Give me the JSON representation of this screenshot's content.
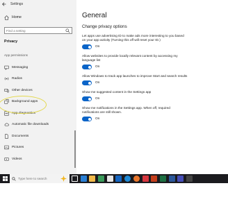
{
  "window": {
    "app_title": "Settings"
  },
  "sidebar": {
    "home_label": "Home",
    "search_placeholder": "Find a setting",
    "section_title": "Privacy",
    "group_label": "App permissions",
    "items": [
      {
        "label": "Messaging",
        "icon": "message-icon"
      },
      {
        "label": "Radios",
        "icon": "radio-icon"
      },
      {
        "label": "Other devices",
        "icon": "devices-icon"
      },
      {
        "label": "Background apps",
        "icon": "background-apps-icon"
      },
      {
        "label": "App diagnostics",
        "icon": "diagnostics-icon"
      },
      {
        "label": "Automatic file downloads",
        "icon": "cloud-icon"
      },
      {
        "label": "Documents",
        "icon": "document-icon"
      },
      {
        "label": "Pictures",
        "icon": "picture-icon"
      },
      {
        "label": "Videos",
        "icon": "video-icon"
      }
    ]
  },
  "main": {
    "title": "General",
    "subheading": "Change privacy options",
    "settings": [
      {
        "text": "Let apps use advertising ID to make ads more interesting to you based on your app activity (Turning this off will reset your ID.)",
        "state": "On"
      },
      {
        "text": "Allow websites to provide locally relevant content by accessing my language list",
        "state": "On"
      },
      {
        "text": "Allow Windows to track app launches to improve Start and search results",
        "state": "On"
      },
      {
        "text": "Show me suggested content in the Settings app",
        "state": "On"
      },
      {
        "text": "Show me notifications in the Settings app. When off, required notifications are still shown.",
        "state": "On"
      }
    ]
  },
  "taskbar": {
    "search_placeholder": "Type here to search"
  },
  "colors": {
    "accent": "#0a64c8",
    "sidebar_bg": "#f2f2f2",
    "taskbar_bg": "#1b1b1f",
    "highlight": "#e3d84c"
  }
}
